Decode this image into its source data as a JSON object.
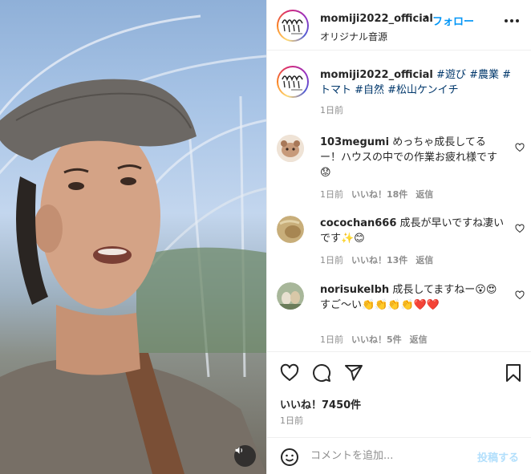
{
  "post": {
    "username": "momiji2022_official",
    "separator": "•",
    "follow_label": "フォロー",
    "audio_label": "オリジナル音源",
    "caption_user": "momiji2022_official",
    "caption_tags": "#遊び #農業 #トマト #自然 #松山ケンイチ",
    "caption_time": "1日前",
    "logo_text": "gunjo"
  },
  "comments": [
    {
      "user": "103megumi",
      "text": "めっちゃ成長してるー！ハウスの中での作業お疲れ様です😟",
      "time": "1日前",
      "likes": "いいね！18件",
      "reply": "返信"
    },
    {
      "user": "cocochan666",
      "text": "成長が早いですね凄いです✨😊",
      "time": "1日前",
      "likes": "いいね！13件",
      "reply": "返信"
    },
    {
      "user": "norisukelbh",
      "text": "成長してますねー😮😍すご〜い👏👏👏👏❤️❤️",
      "time": "1日前",
      "likes": "いいね！5件",
      "reply": "返信"
    }
  ],
  "actions": {
    "like_count": "いいね！7450件",
    "posted_time": "1日前"
  },
  "add_comment": {
    "placeholder": "コメントを追加...",
    "post_label": "投稿する"
  },
  "icons": [
    "more-options-icon",
    "heart-icon",
    "comment-icon",
    "share-icon",
    "bookmark-icon",
    "emoji-icon",
    "sound-icon"
  ],
  "colors": {
    "link": "#0095f6",
    "hashtag": "#00376b",
    "muted": "#8e8e8e"
  }
}
